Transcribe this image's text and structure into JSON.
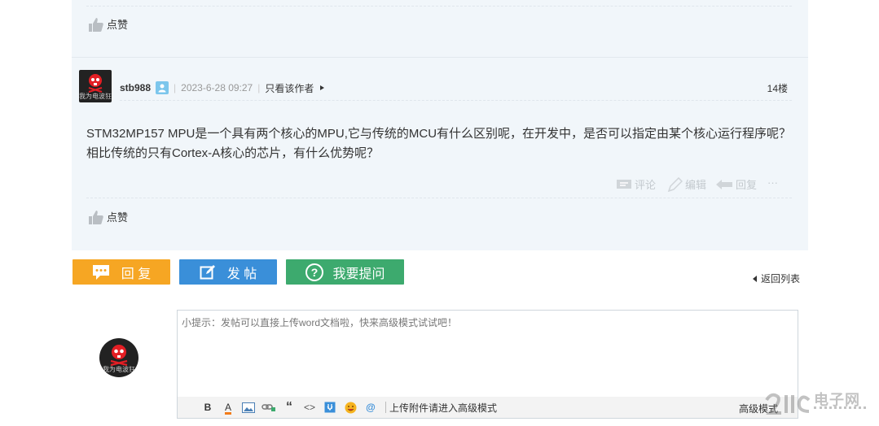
{
  "post_top": {
    "like_label": "点赞"
  },
  "post": {
    "avatar_caption": "我为电波狂",
    "username": "stb988",
    "date": "2023-6-28 09:27",
    "only_author": "只看该作者",
    "floor": "14楼",
    "content": "STM32MP157 MPU是一个具有两个核心的MPU,它与传统的MCU有什么区别呢，在开发中，是否可以指定由某个核心运行程序呢？相比传统的只有Cortex-A核心的芯片，有什么优势呢？",
    "actions": {
      "comment": "评论",
      "edit": "编辑",
      "reply": "回复",
      "more": "···"
    },
    "like_label": "点赞"
  },
  "buttons": {
    "reply": {
      "label": "回 复",
      "color": "#f6a623"
    },
    "new_post": {
      "label": "发 帖",
      "color": "#3a8fd9"
    },
    "ask": {
      "label": "我要提问",
      "color": "#3daa6e"
    }
  },
  "back_to_list": "返回列表",
  "editor": {
    "avatar_caption": "我为电波狂",
    "placeholder": "小提示：发帖可以直接上传word文档啦，快来高级模式试试吧！",
    "toolbar": {
      "bold": "B",
      "font_color": "A",
      "quote": "“",
      "code": "<>",
      "at": "@",
      "upload_hint": "上传附件请进入高级模式",
      "advanced": "高级模式"
    }
  },
  "watermark": "电子网"
}
